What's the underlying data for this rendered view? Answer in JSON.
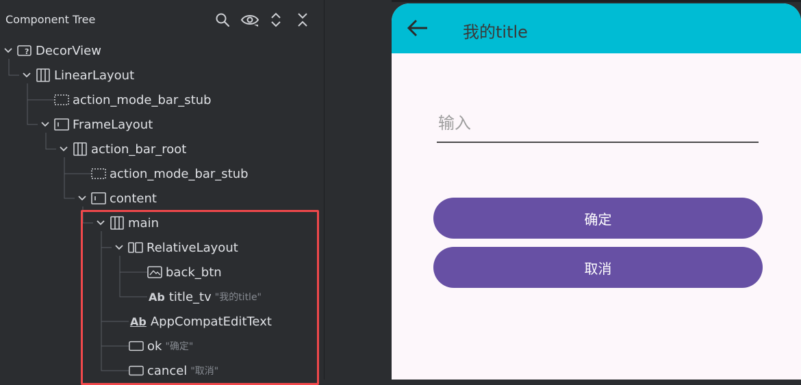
{
  "panel": {
    "title": "Component Tree",
    "tools": [
      "search-icon",
      "eye-icon",
      "expand-icon",
      "collapse-icon"
    ]
  },
  "tree": [
    {
      "label": "DecorView",
      "icon": "window-icon",
      "sub": ""
    },
    {
      "label": "LinearLayout",
      "icon": "linear-layout-icon",
      "sub": ""
    },
    {
      "label": "action_mode_bar_stub",
      "icon": "view-stub-icon",
      "sub": ""
    },
    {
      "label": "FrameLayout",
      "icon": "frame-layout-icon",
      "sub": ""
    },
    {
      "label": "action_bar_root",
      "icon": "linear-layout-icon",
      "sub": ""
    },
    {
      "label": "action_mode_bar_stub",
      "icon": "view-stub-icon",
      "sub": ""
    },
    {
      "label": "content",
      "icon": "frame-layout-icon",
      "sub": ""
    },
    {
      "label": "main",
      "icon": "linear-layout-icon",
      "sub": ""
    },
    {
      "label": "RelativeLayout",
      "icon": "relative-layout-icon",
      "sub": ""
    },
    {
      "label": "back_btn",
      "icon": "image-icon",
      "sub": ""
    },
    {
      "label": "title_tv",
      "icon": "textview-icon",
      "sub": "\"我的title\""
    },
    {
      "label": "AppCompatEditText",
      "icon": "edittext-icon",
      "sub": ""
    },
    {
      "label": "ok",
      "icon": "button-icon",
      "sub": "\"确定\""
    },
    {
      "label": "cancel",
      "icon": "button-icon",
      "sub": "\"取消\""
    }
  ],
  "preview": {
    "title": "我的title",
    "edit_placeholder": "输入",
    "ok_label": "确定",
    "cancel_label": "取消",
    "colors": {
      "app_bar": "#00bcd4",
      "button": "#6750a4",
      "background": "#fdf7fb",
      "highlight": "#f0484b"
    }
  }
}
